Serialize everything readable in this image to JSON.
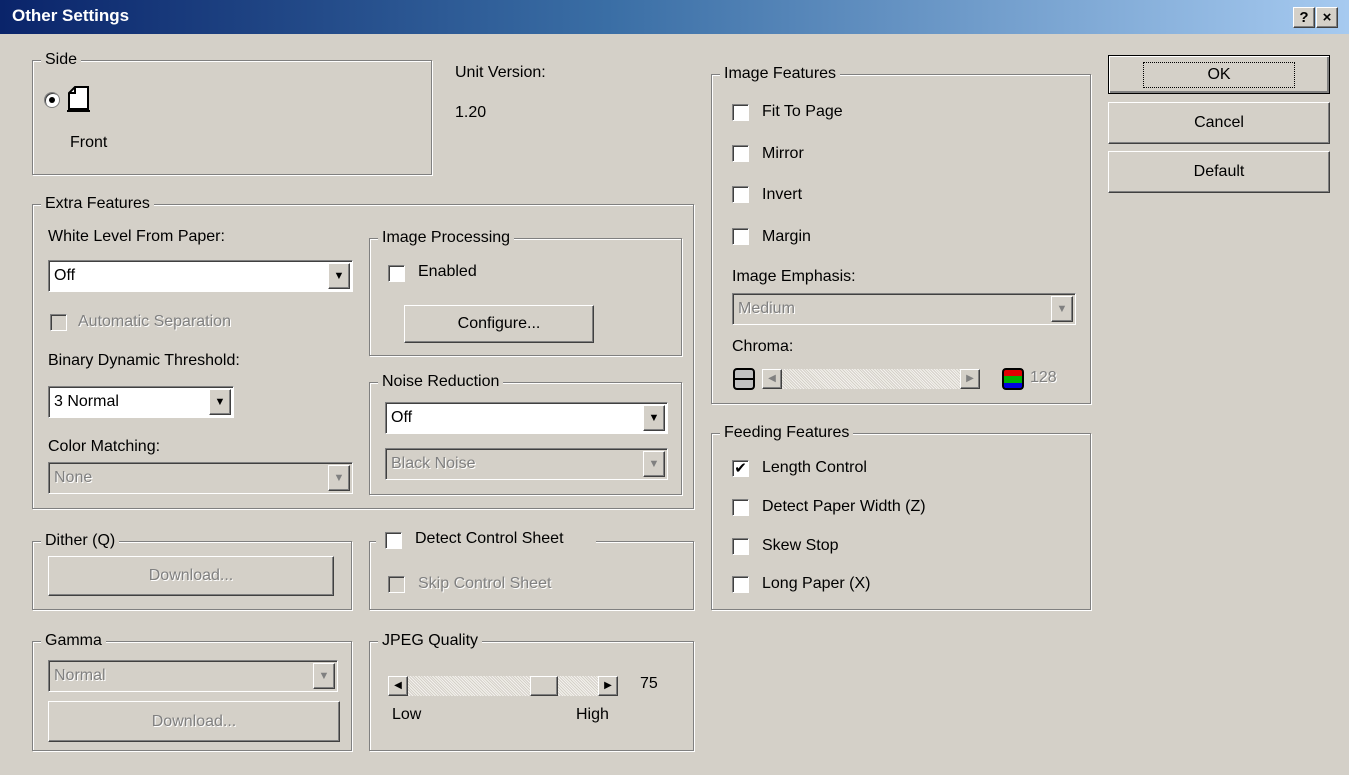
{
  "window": {
    "title": "Other Settings",
    "help_button": "?",
    "close_button": "×"
  },
  "side": {
    "legend": "Side",
    "option_label": "Front",
    "selected": true
  },
  "unit_version": {
    "label": "Unit Version:",
    "value": "1.20"
  },
  "extra_features": {
    "legend": "Extra Features",
    "white_level_label": "White Level From Paper:",
    "white_level_value": "Off",
    "automatic_separation_label": "Automatic Separation",
    "binary_threshold_label": "Binary Dynamic Threshold:",
    "binary_threshold_value": "3 Normal",
    "color_matching_label": "Color Matching:",
    "color_matching_value": "None"
  },
  "image_processing": {
    "legend": "Image Processing",
    "enabled_label": "Enabled",
    "enabled_checked": false,
    "configure_label": "Configure..."
  },
  "noise_reduction": {
    "legend": "Noise Reduction",
    "mode_value": "Off",
    "type_value": "Black Noise"
  },
  "dither": {
    "legend": "Dither (Q)",
    "download_label": "Download..."
  },
  "control_sheet": {
    "detect_label": "Detect Control Sheet",
    "detect_checked": false,
    "skip_label": "Skip Control Sheet",
    "skip_checked": false
  },
  "gamma": {
    "legend": "Gamma",
    "value": "Normal",
    "download_label": "Download..."
  },
  "jpeg_quality": {
    "legend": "JPEG Quality",
    "value": "75",
    "value_fraction": 0.75,
    "low_label": "Low",
    "high_label": "High"
  },
  "image_features": {
    "legend": "Image Features",
    "fit_to_page": "Fit To Page",
    "mirror": "Mirror",
    "invert": "Invert",
    "margin": "Margin",
    "emphasis_label": "Image Emphasis:",
    "emphasis_value": "Medium",
    "chroma_label": "Chroma:",
    "chroma_value": "128"
  },
  "feeding_features": {
    "legend": "Feeding Features",
    "length_control": "Length Control",
    "length_control_checked": true,
    "detect_paper_width": "Detect Paper Width (Z)",
    "skew_stop": "Skew Stop",
    "long_paper": "Long Paper (X)"
  },
  "buttons": {
    "ok": "OK",
    "cancel": "Cancel",
    "default": "Default"
  },
  "colors": {
    "title_start": "#0a246a",
    "title_end": "#a6caf0",
    "face": "#d4d0c8"
  }
}
